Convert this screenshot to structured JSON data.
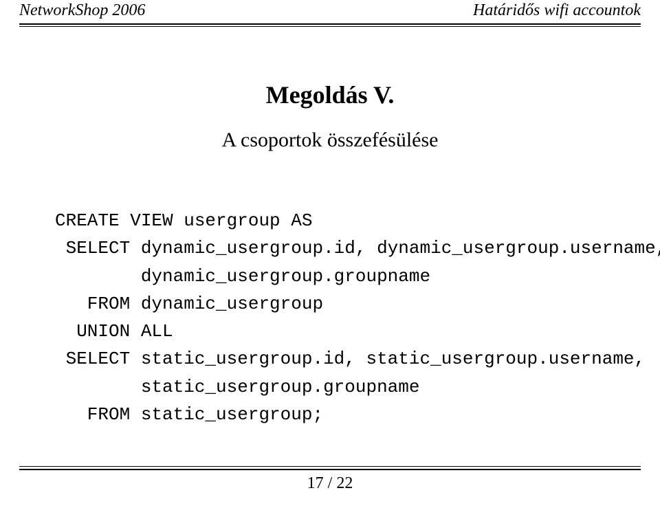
{
  "header": {
    "left": "NetworkShop 2006",
    "right": "Határidős wifi accountok"
  },
  "title": "Megoldás V.",
  "subtitle": "A csoportok összefésülése",
  "code": {
    "l1": "CREATE VIEW usergroup AS",
    "l2": " SELECT dynamic_usergroup.id, dynamic_usergroup.username,",
    "l3": "        dynamic_usergroup.groupname",
    "l4": "   FROM dynamic_usergroup",
    "l5": "  UNION ALL",
    "l6": " SELECT static_usergroup.id, static_usergroup.username,",
    "l7": "        static_usergroup.groupname",
    "l8": "   FROM static_usergroup;"
  },
  "footer": {
    "page": "17 / 22"
  }
}
